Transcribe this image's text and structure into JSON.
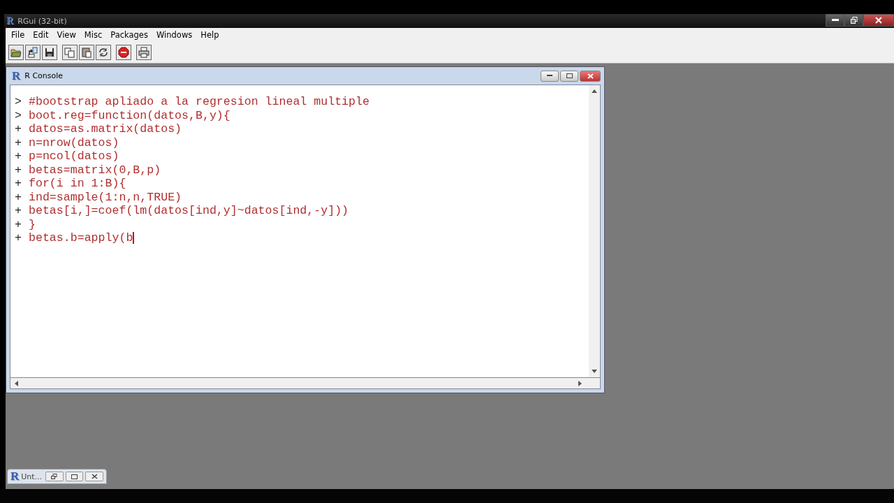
{
  "app": {
    "logo": "R",
    "title": "RGui (32-bit)"
  },
  "menu": [
    "File",
    "Edit",
    "View",
    "Misc",
    "Packages",
    "Windows",
    "Help"
  ],
  "toolbar": [
    {
      "kind": "open"
    },
    {
      "kind": "load"
    },
    {
      "kind": "save"
    },
    {
      "kind": "copy"
    },
    {
      "kind": "paste"
    },
    {
      "kind": "refresh"
    },
    {
      "kind": "stop"
    },
    {
      "kind": "print"
    }
  ],
  "console": {
    "logo": "R",
    "title": "R Console",
    "lines": [
      {
        "prompt": ">",
        "code": "#bootstrap apliado a la regresion lineal multiple",
        "cursor": false
      },
      {
        "prompt": ">",
        "code": "boot.reg=function(datos,B,y){",
        "cursor": false
      },
      {
        "prompt": "+",
        "code": "datos=as.matrix(datos)",
        "cursor": false
      },
      {
        "prompt": "+",
        "code": "n=nrow(datos)",
        "cursor": false
      },
      {
        "prompt": "+",
        "code": "p=ncol(datos)",
        "cursor": false
      },
      {
        "prompt": "+",
        "code": "betas=matrix(0,B,p)",
        "cursor": false
      },
      {
        "prompt": "+",
        "code": "for(i in 1:B){",
        "cursor": false
      },
      {
        "prompt": "+",
        "code": "ind=sample(1:n,n,TRUE)",
        "cursor": false
      },
      {
        "prompt": "+",
        "code": "betas[i,]=coef(lm(datos[ind,y]~datos[ind,-y]))",
        "cursor": false
      },
      {
        "prompt": "+",
        "code": "}",
        "cursor": false
      },
      {
        "prompt": "+",
        "code": "betas.b=apply(b",
        "cursor": true
      }
    ]
  },
  "minimized": {
    "logo": "R",
    "title": "Unt..."
  }
}
